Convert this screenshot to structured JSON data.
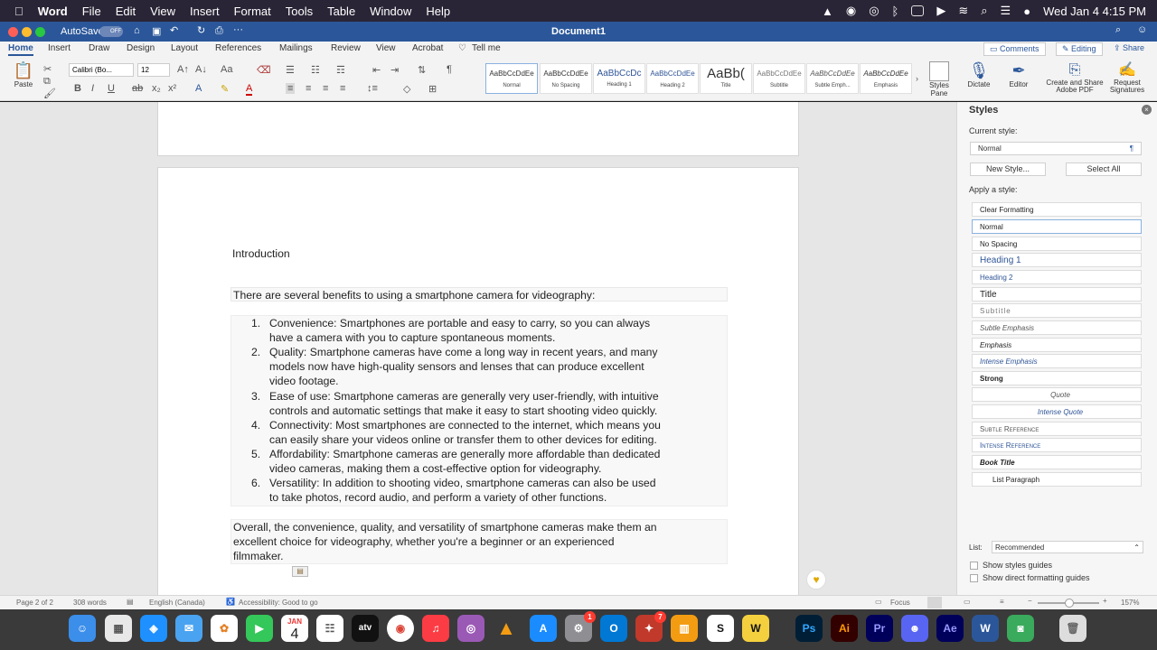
{
  "menubar": {
    "app": "Word",
    "items": [
      "File",
      "Edit",
      "View",
      "Insert",
      "Format",
      "Tools",
      "Table",
      "Window",
      "Help"
    ],
    "datetime": "Wed Jan 4  4:15 PM"
  },
  "titlebar": {
    "autosave": "AutoSave",
    "autosave_state": "OFF",
    "title": "Document1"
  },
  "ribbon_tabs": [
    "Home",
    "Insert",
    "Draw",
    "Design",
    "Layout",
    "References",
    "Mailings",
    "Review",
    "View",
    "Acrobat"
  ],
  "tell_me": "Tell me",
  "right_actions": {
    "comments": "Comments",
    "editing": "Editing",
    "share": "Share"
  },
  "ribbon": {
    "paste": "Paste",
    "font": "Calibri (Bo...",
    "size": "12",
    "styles": [
      {
        "sample": "AaBbCcDdEe",
        "name": "Normal"
      },
      {
        "sample": "AaBbCcDdEe",
        "name": "No Spacing"
      },
      {
        "sample": "AaBbCcDc",
        "name": "Heading 1"
      },
      {
        "sample": "AaBbCcDdEe",
        "name": "Heading 2"
      },
      {
        "sample": "AaBb(",
        "name": "Title"
      },
      {
        "sample": "AaBbCcDdEe",
        "name": "Subtitle"
      },
      {
        "sample": "AaBbCcDdEe",
        "name": "Subtle Emph..."
      },
      {
        "sample": "AaBbCcDdEe",
        "name": "Emphasis"
      }
    ],
    "styles_pane": "Styles Pane",
    "dictate": "Dictate",
    "editor": "Editor",
    "create_share": "Create and Share Adobe PDF",
    "request_sig": "Request Signatures"
  },
  "document": {
    "heading": "Introduction",
    "intro": "There are several benefits to using a smartphone camera for videography:",
    "list": [
      {
        "num": "1.",
        "lines": [
          "Convenience: Smartphones are portable and easy to carry, so you can always",
          "have a camera with you to capture spontaneous moments."
        ]
      },
      {
        "num": "2.",
        "lines": [
          "Quality: Smartphone cameras have come a long way in recent years, and many",
          "models now have high-quality sensors and lenses that can produce excellent",
          "video footage."
        ]
      },
      {
        "num": "3.",
        "lines": [
          "Ease of use: Smartphone cameras are generally very user-friendly, with intuitive",
          "controls and automatic settings that make it easy to start shooting video quickly."
        ]
      },
      {
        "num": "4.",
        "lines": [
          "Connectivity: Most smartphones are connected to the internet, which means you",
          "can easily share your videos online or transfer them to other devices for editing."
        ]
      },
      {
        "num": "5.",
        "lines": [
          "Affordability: Smartphone cameras are generally more affordable than dedicated",
          "video cameras, making them a cost-effective option for videography."
        ]
      },
      {
        "num": "6.",
        "lines": [
          "Versatility: In addition to shooting video, smartphone cameras can also be used",
          "to take photos, record audio, and perform a variety of other functions."
        ]
      }
    ],
    "closing": [
      "Overall, the convenience, quality, and versatility of smartphone cameras make them an",
      "excellent choice for videography, whether you're a beginner or an experienced",
      "filmmaker."
    ]
  },
  "styles_pane": {
    "title": "Styles",
    "current_label": "Current style:",
    "current_value": "Normal",
    "new_style": "New Style...",
    "select_all": "Select All",
    "apply_label": "Apply a style:",
    "items": [
      "Clear Formatting",
      "Normal",
      "No Spacing",
      "Heading 1",
      "Heading 2",
      "Title",
      "Subtitle",
      "Subtle Emphasis",
      "Emphasis",
      "Intense Emphasis",
      "Strong",
      "Quote",
      "Intense Quote",
      "Subtle Reference",
      "Intense Reference",
      "Book Title",
      "List Paragraph"
    ],
    "list_label": "List:",
    "list_value": "Recommended",
    "guides": "Show styles guides",
    "direct_guides": "Show direct formatting guides"
  },
  "statusbar": {
    "page": "Page 2 of 2",
    "words": "308 words",
    "language": "English (Canada)",
    "accessibility": "Accessibility: Good to go",
    "focus": "Focus",
    "zoom": "157%"
  },
  "dock": {
    "calendar_month": "JAN",
    "calendar_day": "4",
    "tv": "atv",
    "ps": "Ps",
    "ai": "Ai",
    "pr": "Pr",
    "ae": "Ae",
    "notif_settings": "1",
    "notif_photos": "7"
  }
}
